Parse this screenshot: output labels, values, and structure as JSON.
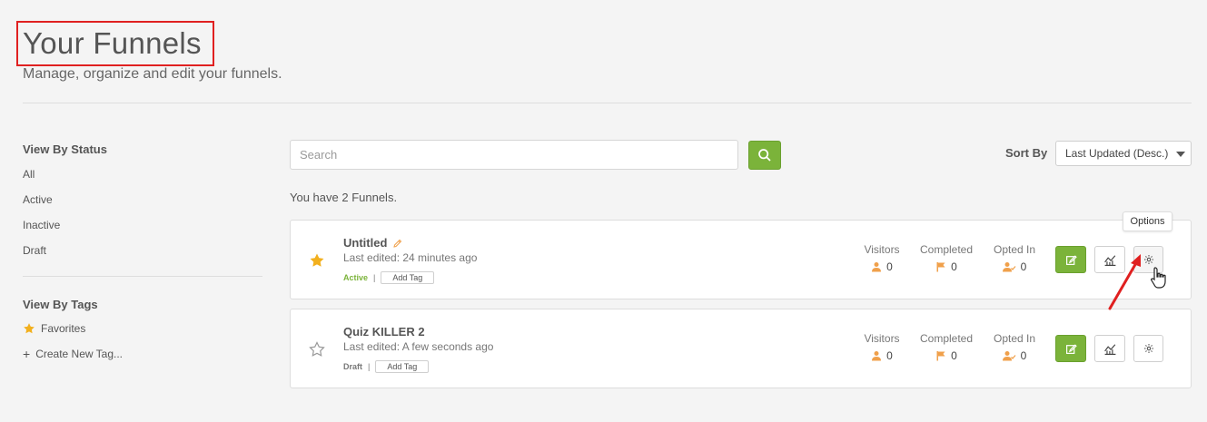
{
  "header": {
    "title": "Your Funnels",
    "subtitle": "Manage, organize and edit your funnels."
  },
  "sidebar": {
    "status_heading": "View By Status",
    "status_items": [
      "All",
      "Active",
      "Inactive",
      "Draft"
    ],
    "tags_heading": "View By Tags",
    "favorites_label": "Favorites",
    "create_tag_label": "Create New Tag..."
  },
  "toolbar": {
    "search_placeholder": "Search",
    "search_value": "",
    "sort_label": "Sort By",
    "sort_value": "Last Updated (Desc.)"
  },
  "funnel_count_text": "You have 2 Funnels.",
  "funnels": [
    {
      "name": "Untitled",
      "edited": "Last edited: 24 minutes ago",
      "status": "Active",
      "starred": true,
      "add_tag_label": "Add Tag",
      "stats": [
        {
          "label": "Visitors",
          "value": "0",
          "icon": "user-icon"
        },
        {
          "label": "Completed",
          "value": "0",
          "icon": "flag-icon"
        },
        {
          "label": "Opted In",
          "value": "0",
          "icon": "user-check-icon"
        }
      ]
    },
    {
      "name": "Quiz KILLER 2",
      "edited": "Last edited: A few seconds ago",
      "status": "Draft",
      "starred": false,
      "add_tag_label": "Add Tag",
      "stats": [
        {
          "label": "Visitors",
          "value": "0",
          "icon": "user-icon"
        },
        {
          "label": "Completed",
          "value": "0",
          "icon": "flag-icon"
        },
        {
          "label": "Opted In",
          "value": "0",
          "icon": "user-check-icon"
        }
      ]
    }
  ],
  "tooltip": {
    "text": "Options"
  },
  "colors": {
    "accent_green": "#7bb33a",
    "highlight_red": "#e02020",
    "star_gold": "#f2b01e",
    "stat_orange": "#f0a04b"
  }
}
